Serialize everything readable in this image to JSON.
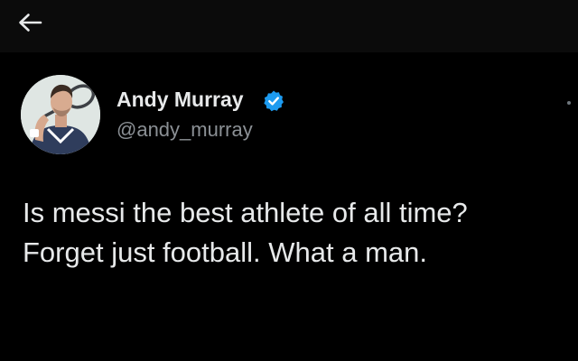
{
  "header": {
    "back_icon": "arrow-left-icon"
  },
  "tweet": {
    "author": {
      "display_name": "Andy Murray",
      "handle": "@andy_murray",
      "verified": true,
      "verified_color": "#1d9bf0",
      "avatar_icon": "profile-photo"
    },
    "text_lines": [
      "Is messi the best athlete of all time?",
      "Forget just football. What a man."
    ]
  },
  "colors": {
    "background": "#000000",
    "text_primary": "#e7e9ea",
    "text_secondary": "#8b9095",
    "accent": "#1d9bf0"
  }
}
